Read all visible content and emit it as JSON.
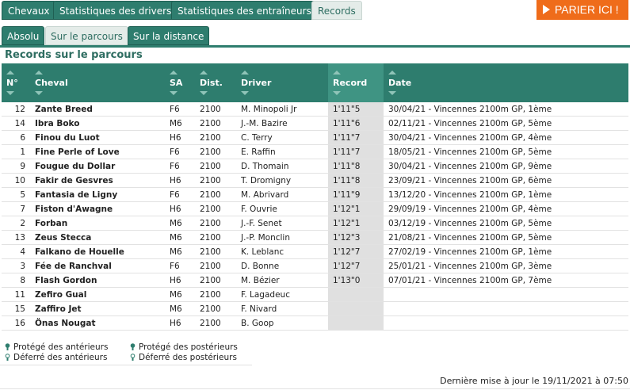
{
  "top_tabs": [
    {
      "label": "Chevaux",
      "active": false
    },
    {
      "label": "Statistiques des drivers",
      "active": false
    },
    {
      "label": "Statistiques des entraîneurs",
      "active": false
    },
    {
      "label": "Records",
      "active": true
    }
  ],
  "cta": {
    "label": "PARIER ICI !",
    "color": "#ef6c1a"
  },
  "sub_tabs": [
    {
      "label": "Absolu",
      "active": false
    },
    {
      "label": "Sur le parcours",
      "active": true
    },
    {
      "label": "Sur la distance",
      "active": false
    }
  ],
  "section_title": "Records sur le parcours",
  "table": {
    "headers": [
      "N°",
      "Cheval",
      "SA",
      "Dist.",
      "Driver",
      "Record",
      "Date"
    ],
    "sorted_column": "Record",
    "rows": [
      [
        "12",
        "Zante Breed",
        "F6",
        "2100",
        "M. Minopoli Jr",
        "1'11\"5",
        "30/04/21 - Vincennes 2100m GP, 1ème"
      ],
      [
        "14",
        "Ibra Boko",
        "M6",
        "2100",
        "J.-M. Bazire",
        "1'11\"6",
        "02/11/21 - Vincennes 2100m GP, 5ème"
      ],
      [
        "6",
        "Finou du Luot",
        "H6",
        "2100",
        "C. Terry",
        "1'11\"7",
        "30/04/21 - Vincennes 2100m GP, 4ème"
      ],
      [
        "1",
        "Fine Perle of Love",
        "F6",
        "2100",
        "E. Raffin",
        "1'11\"7",
        "18/05/21 - Vincennes 2100m GP, 5ème"
      ],
      [
        "9",
        "Fougue du Dollar",
        "F6",
        "2100",
        "D. Thomain",
        "1'11\"8",
        "30/04/21 - Vincennes 2100m GP, 9ème"
      ],
      [
        "10",
        "Fakir de Gesvres",
        "H6",
        "2100",
        "T. Dromigny",
        "1'11\"8",
        "23/09/21 - Vincennes 2100m GP, 6ème"
      ],
      [
        "5",
        "Fantasia de Ligny",
        "F6",
        "2100",
        "M. Abrivard",
        "1'11\"9",
        "13/12/20 - Vincennes 2100m GP, 1ème"
      ],
      [
        "7",
        "Fiston d'Awagne",
        "H6",
        "2100",
        "F. Ouvrie",
        "1'12\"1",
        "29/09/19 - Vincennes 2100m GP, 4ème"
      ],
      [
        "2",
        "Forban",
        "M6",
        "2100",
        "J.-F. Senet",
        "1'12\"1",
        "03/12/19 - Vincennes 2100m GP, 5ème"
      ],
      [
        "13",
        "Zeus Stecca",
        "M6",
        "2100",
        "J.-P. Monclin",
        "1'12\"3",
        "21/08/21 - Vincennes 2100m GP, 5ème"
      ],
      [
        "4",
        "Falkano de Houelle",
        "M6",
        "2100",
        "K. Leblanc",
        "1'12\"7",
        "27/02/19 - Vincennes 2100m GP, 1ème"
      ],
      [
        "3",
        "Fée de Ranchval",
        "F6",
        "2100",
        "D. Bonne",
        "1'12\"7",
        "25/01/21 - Vincennes 2100m GP, 3ème"
      ],
      [
        "8",
        "Flash Gordon",
        "H6",
        "2100",
        "M. Bézier",
        "1'13\"0",
        "07/01/21 - Vincennes 2100m GP, 7ème"
      ],
      [
        "11",
        "Zefiro Gual",
        "M6",
        "2100",
        "F. Lagadeuc",
        "",
        ""
      ],
      [
        "15",
        "Zaffiro Jet",
        "M6",
        "2100",
        "F. Nivard",
        "",
        ""
      ],
      [
        "16",
        "Önas Nougat",
        "H6",
        "2100",
        "B. Goop",
        "",
        ""
      ]
    ]
  },
  "legend": {
    "protege_anterieurs": "Protégé des antérieurs",
    "defere_anterieurs": "Déferré des antérieurs",
    "protege_posterieurs": "Protégé des postérieurs",
    "defere_posterieurs": "Déferré des postérieurs"
  },
  "last_update": "Dernière mise à jour le 19/11/2021 à 07:50",
  "colors": {
    "primary": "#2e7d6e",
    "record_column": "#e0e0e0"
  }
}
